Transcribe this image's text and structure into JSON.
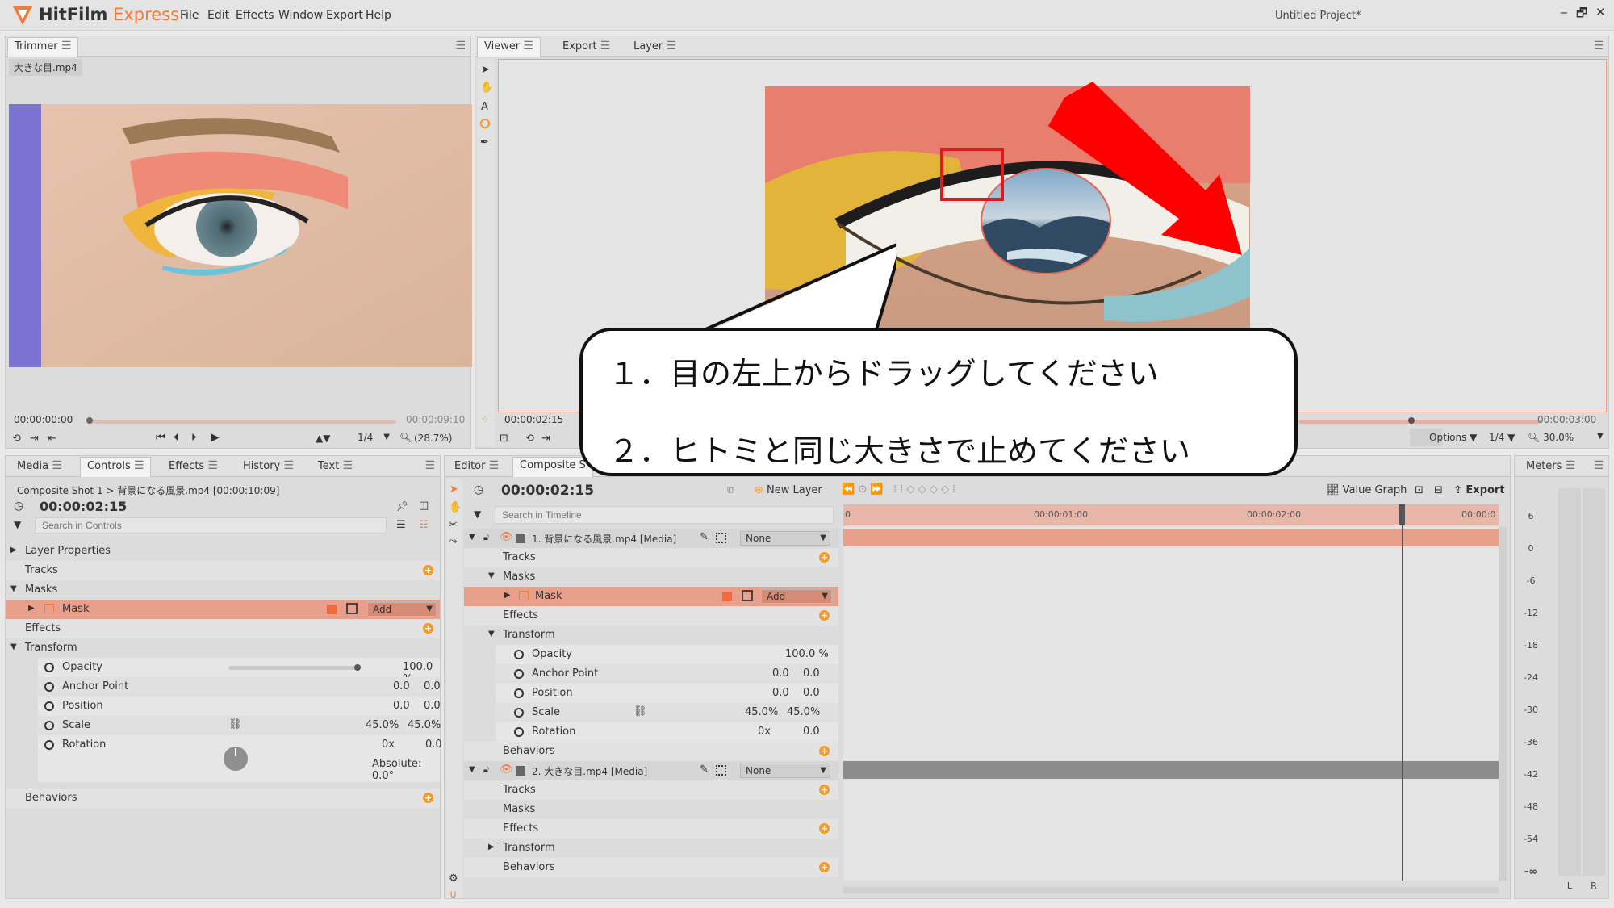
{
  "app": {
    "name_main": "HitFilm",
    "name_sub": " Express",
    "project": "Untitled Project*"
  },
  "menu": [
    "File",
    "Edit",
    "Effects",
    "Window",
    "Export",
    "Help"
  ],
  "window_controls": [
    "‒",
    "🗗",
    "✕"
  ],
  "trimmer": {
    "tab": "Trimmer",
    "file": "大きな目.mp4",
    "time_current": "00:00:00:00",
    "time_end": "00:00:09:10",
    "res": "1/4",
    "zoom": "(28.7%)"
  },
  "viewer": {
    "tabs": [
      "Viewer",
      "Export",
      "Layer"
    ],
    "time_current": "00:00:02:15",
    "time_end": "00:00:03:00",
    "options": "Options",
    "res": "1/4",
    "zoom": "30.0%"
  },
  "controls_panel": {
    "tabs": [
      "Media",
      "Controls",
      "Effects",
      "History",
      "Text"
    ],
    "breadcrumb": "Composite Shot 1 > 背景になる風景.mp4 [00:00:10:09]",
    "time": "00:00:02:15",
    "search_placeholder": "Search in Controls",
    "layer_properties": "Layer Properties",
    "tracks": "Tracks",
    "masks": "Masks",
    "mask": "Mask",
    "mask_mode": "Add",
    "effects": "Effects",
    "transform": "Transform",
    "opacity": "Opacity",
    "opacity_val": "100.0 %",
    "anchor": "Anchor Point",
    "anchor_x": "0.0",
    "anchor_y": "0.0",
    "position": "Position",
    "position_x": "0.0",
    "position_y": "0.0",
    "scale": "Scale",
    "scale_x": "45.0%",
    "scale_y": "45.0%",
    "rotation": "Rotation",
    "rotation_turns": "0x",
    "rotation_val": "0.0",
    "absolute": "Absolute: 0.0°",
    "behaviors": "Behaviors"
  },
  "editor": {
    "tabs": [
      "Editor",
      "Composite S"
    ],
    "time": "00:00:02:15",
    "new_layer": "New Layer",
    "value_graph": "Value Graph",
    "export": "Export",
    "search_placeholder": "Search in Timeline",
    "ruler": [
      "0",
      "00:00:01:00",
      "00:00:02:00",
      "00:00:0"
    ],
    "layer1": "1. 背景になる風景.mp4 [Media]",
    "layer1_blend": "None",
    "layer2": "2. 大きな目.mp4 [Media]",
    "layer2_blend": "None",
    "tracks": "Tracks",
    "masks": "Masks",
    "mask": "Mask",
    "mask_mode": "Add",
    "effects": "Effects",
    "transform": "Transform",
    "behaviors": "Behaviors",
    "opacity": "Opacity",
    "opacity_val": "100.0 %",
    "anchor": "Anchor Point",
    "anchor_x": "0.0",
    "anchor_y": "0.0",
    "position": "Position",
    "position_x": "0.0",
    "position_y": "0.0",
    "scale": "Scale",
    "scale_x": "45.0%",
    "scale_y": "45.0%",
    "rotation": "Rotation",
    "rotation_turns": "0x",
    "rotation_val": "0.0"
  },
  "meters": {
    "tab": "Meters",
    "scale": [
      "6",
      "0",
      "-6",
      "-12",
      "-18",
      "-24",
      "-30",
      "-36",
      "-42",
      "-48",
      "-54",
      "-∞"
    ],
    "channels": [
      "L",
      "R"
    ]
  },
  "annotation": {
    "line1": "１．目の左上からドラッグしてください",
    "line2": "２．ヒトミと同じ大きさで止めてください"
  },
  "colors": {
    "accent": "#f07b3c",
    "selection": "#e8a08c",
    "arrow": "#ff0000"
  }
}
